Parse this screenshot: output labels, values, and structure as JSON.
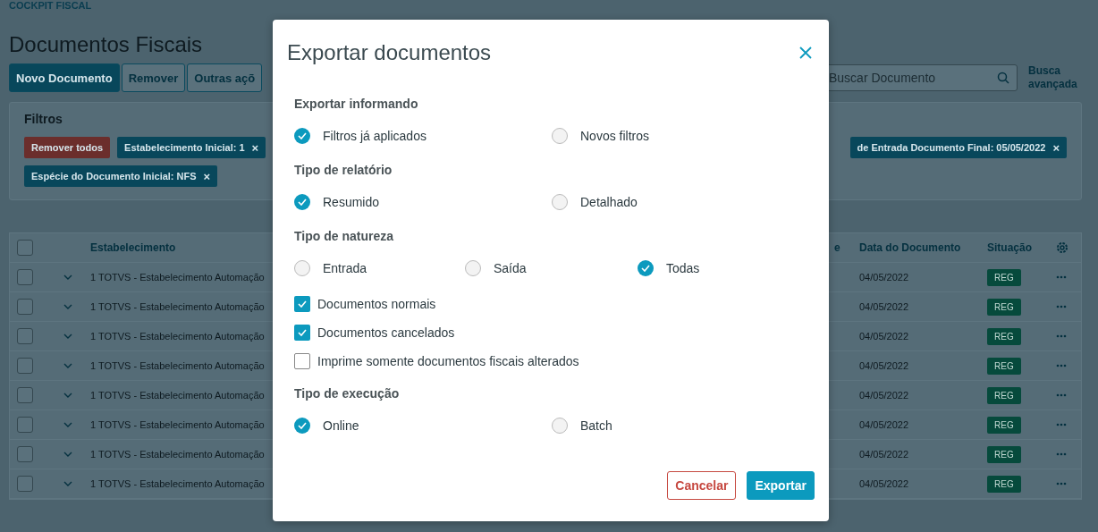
{
  "page": {
    "breadcrumb": "COCKPIT FISCAL",
    "title": "Documentos Fiscais",
    "actions": [
      {
        "label": "Novo Documento",
        "primary": true
      },
      {
        "label": "Remover",
        "primary": false
      },
      {
        "label": "Outras açõ",
        "primary": false
      }
    ],
    "search": {
      "placeholder": "Buscar Documento"
    },
    "advanced_search": "Busca avançada",
    "filters": {
      "title": "Filtros",
      "clear_label": "Remover todos",
      "chips": [
        {
          "label": "Estabelecimento Inicial: 1",
          "close": "×"
        },
        {
          "label": "de Entrada Documento Final: 05/05/2022",
          "close": "×"
        },
        {
          "label": "Espécie do Documento Inicial: NFS",
          "close": "×"
        }
      ]
    },
    "table": {
      "all_checked": false,
      "columns": [
        "Estabelecimento",
        "e",
        "Data do Documento",
        "Situação"
      ],
      "rows": [
        {
          "checked": false,
          "establishment": "1 TOTVS - Estabelecimento Automação",
          "date": "04/05/2022",
          "status": "REG"
        },
        {
          "checked": false,
          "establishment": "1 TOTVS - Estabelecimento Automação",
          "date": "04/05/2022",
          "status": "REG"
        },
        {
          "checked": false,
          "establishment": "1 TOTVS - Estabelecimento Automação",
          "date": "04/05/2022",
          "status": "REG"
        },
        {
          "checked": false,
          "establishment": "1 TOTVS - Estabelecimento Automação",
          "date": "04/05/2022",
          "status": "REG"
        },
        {
          "checked": false,
          "establishment": "1 TOTVS - Estabelecimento Automação",
          "date": "04/05/2022",
          "status": "REG"
        },
        {
          "checked": false,
          "establishment": "1 TOTVS - Estabelecimento Automação",
          "date": "04/05/2022",
          "status": "REG"
        },
        {
          "checked": false,
          "establishment": "1 TOTVS - Estabelecimento Automação",
          "date": "04/05/2022",
          "status": "REG"
        },
        {
          "checked": false,
          "establishment": "1 TOTVS - Estabelecimento Automação",
          "date": "04/05/2022",
          "status": "REG"
        }
      ]
    }
  },
  "modal": {
    "title": "Exportar documentos",
    "sections": [
      {
        "kind": "radio",
        "label": "Exportar informando",
        "options": [
          {
            "label": "Filtros já aplicados",
            "selected": true
          },
          {
            "label": "Novos filtros",
            "selected": false
          }
        ]
      },
      {
        "kind": "radio",
        "label": "Tipo de relatório",
        "options": [
          {
            "label": "Resumido",
            "selected": true
          },
          {
            "label": "Detalhado",
            "selected": false
          }
        ]
      },
      {
        "kind": "radio",
        "label": "Tipo de natureza",
        "options": [
          {
            "label": "Entrada",
            "selected": false
          },
          {
            "label": "Saída",
            "selected": false
          },
          {
            "label": "Todas",
            "selected": true
          }
        ]
      },
      {
        "kind": "checkbox",
        "options": [
          {
            "label": "Documentos normais",
            "checked": true
          },
          {
            "label": "Documentos cancelados",
            "checked": true
          },
          {
            "label": "Imprime somente documentos fiscais alterados",
            "checked": false
          }
        ]
      },
      {
        "kind": "radio",
        "label": "Tipo de execução",
        "options": [
          {
            "label": "Online",
            "selected": true
          },
          {
            "label": "Batch",
            "selected": false
          }
        ]
      }
    ],
    "buttons": [
      {
        "label": "Cancelar",
        "primary": false
      },
      {
        "label": "Exportar",
        "primary": true
      }
    ]
  }
}
